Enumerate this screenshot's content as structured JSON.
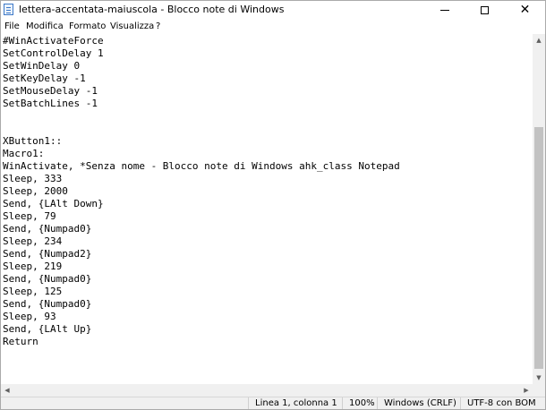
{
  "window": {
    "title": "lettera-accentata-maiuscola - Blocco note di Windows",
    "minimize_icon": "minimize-icon",
    "maximize_icon": "maximize-icon",
    "close_icon": "close-icon",
    "close_glyph": "✕"
  },
  "menu": {
    "items": [
      "File",
      "Modifica",
      "Formato",
      "Visualizza",
      "?"
    ]
  },
  "editor": {
    "lines": [
      "#WinActivateForce",
      "SetControlDelay 1",
      "SetWinDelay 0",
      "SetKeyDelay -1",
      "SetMouseDelay -1",
      "SetBatchLines -1",
      "",
      "",
      "XButton1::",
      "Macro1:",
      "WinActivate, *Senza nome - Blocco note di Windows ahk_class Notepad",
      "Sleep, 333",
      "Sleep, 2000",
      "Send, {LAlt Down}",
      "Sleep, 79",
      "Send, {Numpad0}",
      "Sleep, 234",
      "Send, {Numpad2}",
      "Sleep, 219",
      "Send, {Numpad0}",
      "Sleep, 125",
      "Send, {Numpad0}",
      "Sleep, 93",
      "Send, {LAlt Up}",
      "Return"
    ]
  },
  "scrollbars": {
    "up_glyph": "▲",
    "down_glyph": "▼",
    "left_glyph": "◀",
    "right_glyph": "▶"
  },
  "status": {
    "position": "Linea 1, colonna 1",
    "zoom": "100%",
    "line_ending": "Windows (CRLF)",
    "encoding": "UTF-8 con BOM"
  }
}
